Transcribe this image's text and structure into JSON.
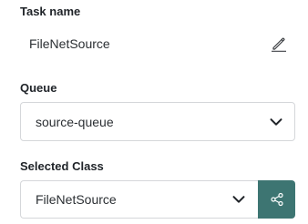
{
  "task": {
    "label": "Task name",
    "value": "FileNetSource",
    "edit_icon": "pencil-icon"
  },
  "queue": {
    "label": "Queue",
    "selected": "source-queue",
    "chevron_icon": "chevron-down-icon"
  },
  "selected_class": {
    "label": "Selected Class",
    "selected": "FileNetSource",
    "chevron_icon": "chevron-down-icon",
    "share_icon": "share-icon"
  },
  "colors": {
    "accent": "#3d7572",
    "border": "#d5d7da",
    "text": "#1f2328"
  }
}
